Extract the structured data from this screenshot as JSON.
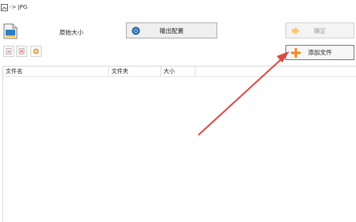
{
  "window": {
    "title": "-> JPG"
  },
  "header": {
    "original_size_label": "原始大小"
  },
  "toolbar": {
    "output_button": "输出配置",
    "confirm_button": "确定",
    "add_file_button": "添加文件"
  },
  "table": {
    "columns": [
      "文件名",
      "文件夹",
      "大小"
    ],
    "rows": []
  },
  "colors": {
    "annotation_arrow": "#d94a44",
    "add_icon": "#f08a1c",
    "confirm_icon": "#f7c873"
  },
  "icons": {
    "title": "picture-icon",
    "output": "swirl-icon",
    "confirm": "arrow-right-icon",
    "add": "plus-icon",
    "tools": [
      "remove-icon",
      "clear-icon",
      "settings-icon"
    ]
  }
}
